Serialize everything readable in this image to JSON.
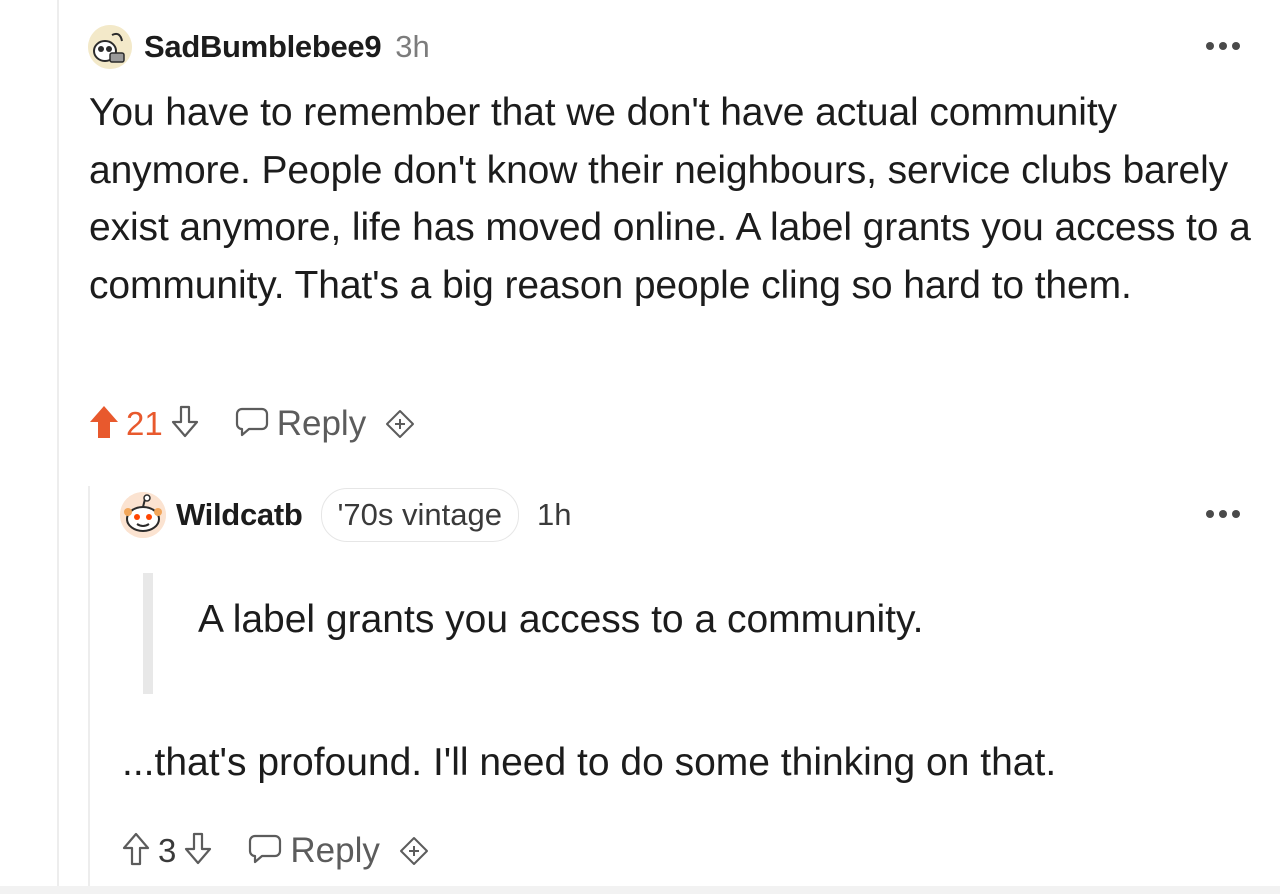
{
  "parent_comment": {
    "author": "SadBumblebee9",
    "time": "3h",
    "body": "You have to remember that we don't have actual community anymore. People don't know their neighbours, service clubs barely exist anymore, life has moved online. A label grants you access to a community. That's a big reason people cling so hard to them.",
    "score": "21",
    "reply_label": "Reply",
    "vote_state": "upvoted",
    "accent_color": "#e8592d"
  },
  "child_comment": {
    "author": "Wildcatb",
    "flair": "'70s vintage",
    "time": "1h",
    "quote": "A label grants you access to a community.",
    "body": "...that's profound. I'll need to do some thinking on that.",
    "score": "3",
    "reply_label": "Reply"
  },
  "icons": {
    "more": "more-options-icon",
    "upvote": "upvote-arrow-icon",
    "downvote": "downvote-arrow-icon",
    "reply": "speech-bubble-icon",
    "award": "award-plus-icon"
  }
}
